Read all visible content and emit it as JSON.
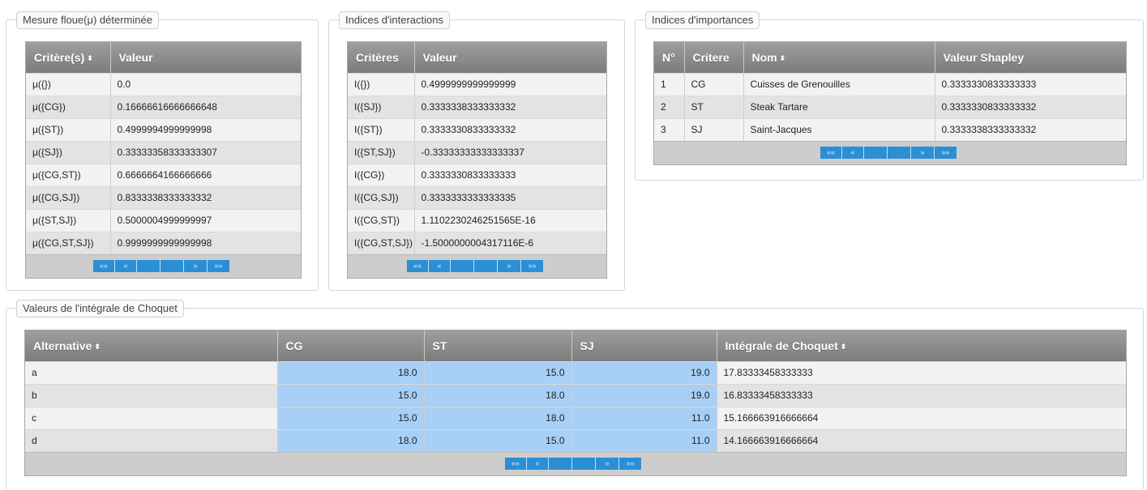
{
  "panels": {
    "mesure": {
      "legend": "Mesure floue(μ) déterminée"
    },
    "interactions": {
      "legend": "Indices d'interactions"
    },
    "importances": {
      "legend": "Indices d'importances"
    },
    "choquet": {
      "legend": "Valeurs de l'intégrale de Choquet"
    }
  },
  "mesure_table": {
    "headers": [
      "Critère(s)",
      "Valeur"
    ],
    "rows": [
      [
        "μ({})",
        "0.0"
      ],
      [
        "μ({CG})",
        "0.16666616666666648"
      ],
      [
        "μ({ST})",
        "0.4999994999999998"
      ],
      [
        "μ({SJ})",
        "0.33333358333333307"
      ],
      [
        "μ({CG,ST})",
        "0.6666664166666666"
      ],
      [
        "μ({CG,SJ})",
        "0.8333338333333332"
      ],
      [
        "μ({ST,SJ})",
        "0.5000004999999997"
      ],
      [
        "μ({CG,ST,SJ})",
        "0.9999999999999998"
      ]
    ]
  },
  "interactions_table": {
    "headers": [
      "Critères",
      "Valeur"
    ],
    "rows": [
      [
        "I({})",
        "0.4999999999999999"
      ],
      [
        "I({SJ})",
        "0.3333338333333332"
      ],
      [
        "I({ST})",
        "0.3333330833333332"
      ],
      [
        "I({ST,SJ})",
        "-0.33333333333333337"
      ],
      [
        "I({CG})",
        "0.3333330833333333"
      ],
      [
        "I({CG,SJ})",
        "0.3333333333333335"
      ],
      [
        "I({CG,ST})",
        "1.1102230246251565E-16"
      ],
      [
        "I({CG,ST,SJ})",
        "-1.5000000004317116E-6"
      ]
    ]
  },
  "importances_table": {
    "headers": [
      "N°",
      "Critere",
      "Nom",
      "Valeur Shapley"
    ],
    "rows": [
      [
        "1",
        "CG",
        "Cuisses de Grenouilles",
        "0.3333330833333333"
      ],
      [
        "2",
        "ST",
        "Steak Tartare",
        "0.3333330833333332"
      ],
      [
        "3",
        "SJ",
        "Saint-Jacques",
        "0.3333338333333332"
      ]
    ]
  },
  "choquet_table": {
    "headers": [
      "Alternative",
      "CG",
      "ST",
      "SJ",
      "Intégrale de Choquet"
    ],
    "rows": [
      [
        "a",
        "18.0",
        "15.0",
        "19.0",
        "17.83333458333333"
      ],
      [
        "b",
        "15.0",
        "18.0",
        "19.0",
        "16.83333458333333"
      ],
      [
        "c",
        "15.0",
        "18.0",
        "11.0",
        "15.166663916666664"
      ],
      [
        "d",
        "18.0",
        "15.0",
        "11.0",
        "14.166663916666664"
      ]
    ]
  },
  "icons": {
    "sort": "sort-both-icon",
    "first": "«« ",
    "prev": "«",
    "next": "»",
    "last": "»»"
  },
  "pager": {
    "first": "««",
    "prev": "«",
    "next": "»",
    "last": "»»"
  },
  "colors": {
    "header": "#8a8a8a",
    "highlight": "#a8cff5",
    "pager_button": "#2b8fd6"
  }
}
